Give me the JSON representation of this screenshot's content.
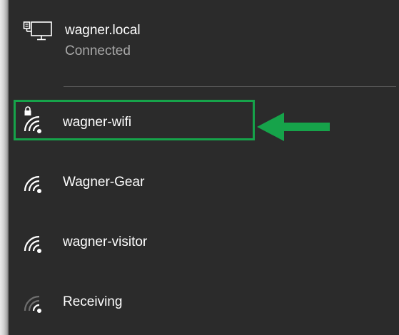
{
  "ethernet": {
    "name": "wagner.local",
    "status": "Connected",
    "icon": "ethernet-monitor-icon"
  },
  "networks": [
    {
      "name": "wagner-wifi",
      "secured": true,
      "signal": "full",
      "icon": "wifi-signal-icon"
    },
    {
      "name": "Wagner-Gear",
      "secured": false,
      "signal": "full",
      "icon": "wifi-signal-icon"
    },
    {
      "name": "wagner-visitor",
      "secured": false,
      "signal": "full",
      "icon": "wifi-signal-icon"
    },
    {
      "name": "Receiving",
      "secured": false,
      "signal": "low",
      "icon": "wifi-signal-icon"
    }
  ],
  "annotation": {
    "highlight_color": "#16a34a",
    "arrow_color": "#16a34a",
    "highlighted_network": "wagner-wifi"
  },
  "colors": {
    "panel_background": "#2b2b2b",
    "text_primary": "#ffffff",
    "text_secondary": "#a8a8a8",
    "signal_dim": "#6f6f6f"
  }
}
